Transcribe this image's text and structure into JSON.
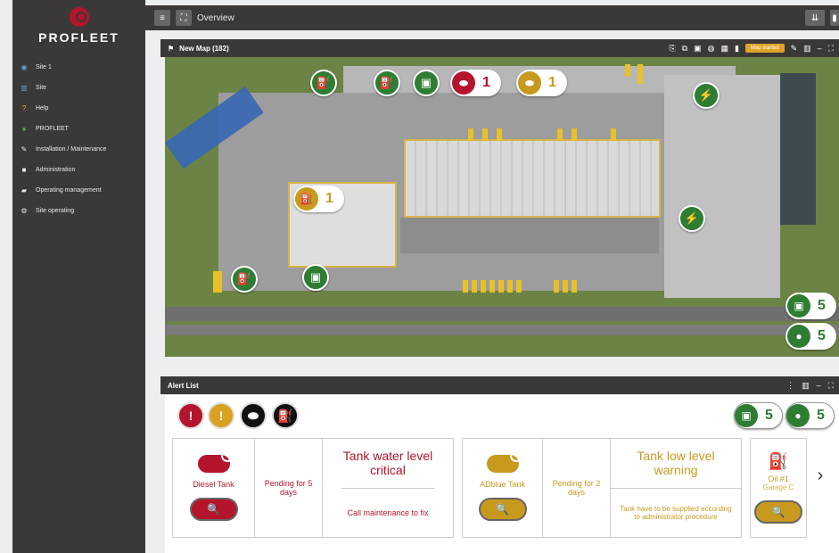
{
  "brand": {
    "name": "PROFLEET"
  },
  "sidebar": {
    "items": [
      {
        "label": "Site 1",
        "icon": "globe-icon"
      },
      {
        "label": "Site",
        "icon": "building-icon"
      },
      {
        "label": "Help",
        "icon": "question-icon"
      },
      {
        "label": "PROFLEET",
        "icon": "user-icon"
      },
      {
        "label": "Installation / Maintenance",
        "icon": "wrench-icon"
      },
      {
        "label": "Administration",
        "icon": "folder-icon"
      },
      {
        "label": "Operating management",
        "icon": "truck-icon"
      },
      {
        "label": "Site operating",
        "icon": "gear-icon"
      }
    ]
  },
  "topbar": {
    "title": "Overview"
  },
  "map_panel": {
    "title": "New Map (182)",
    "badge": "Map started",
    "counts": {
      "red_tank": "1",
      "gold_tank": "1",
      "oil": "1",
      "station": "5",
      "person": "5"
    }
  },
  "alert_panel": {
    "title": "Alert List",
    "counts": {
      "station": "5",
      "person": "5"
    },
    "cards": [
      {
        "name": "Diesel Tank",
        "pending": "Pending for 5 days",
        "title": "Tank water level critical",
        "action": "Call maintenance to fix"
      },
      {
        "name": "ADblue Tank",
        "pending": "Pending for 2 days",
        "title": "Tank low level warning",
        "action": "Tank have to be supplied according to administrator procedure"
      },
      {
        "name": "Oil #1",
        "sub": "Garage C"
      }
    ]
  },
  "colors": {
    "red": "#b4152c",
    "gold": "#c79a1e",
    "green": "#2e7d32",
    "dark": "#3b3938"
  }
}
